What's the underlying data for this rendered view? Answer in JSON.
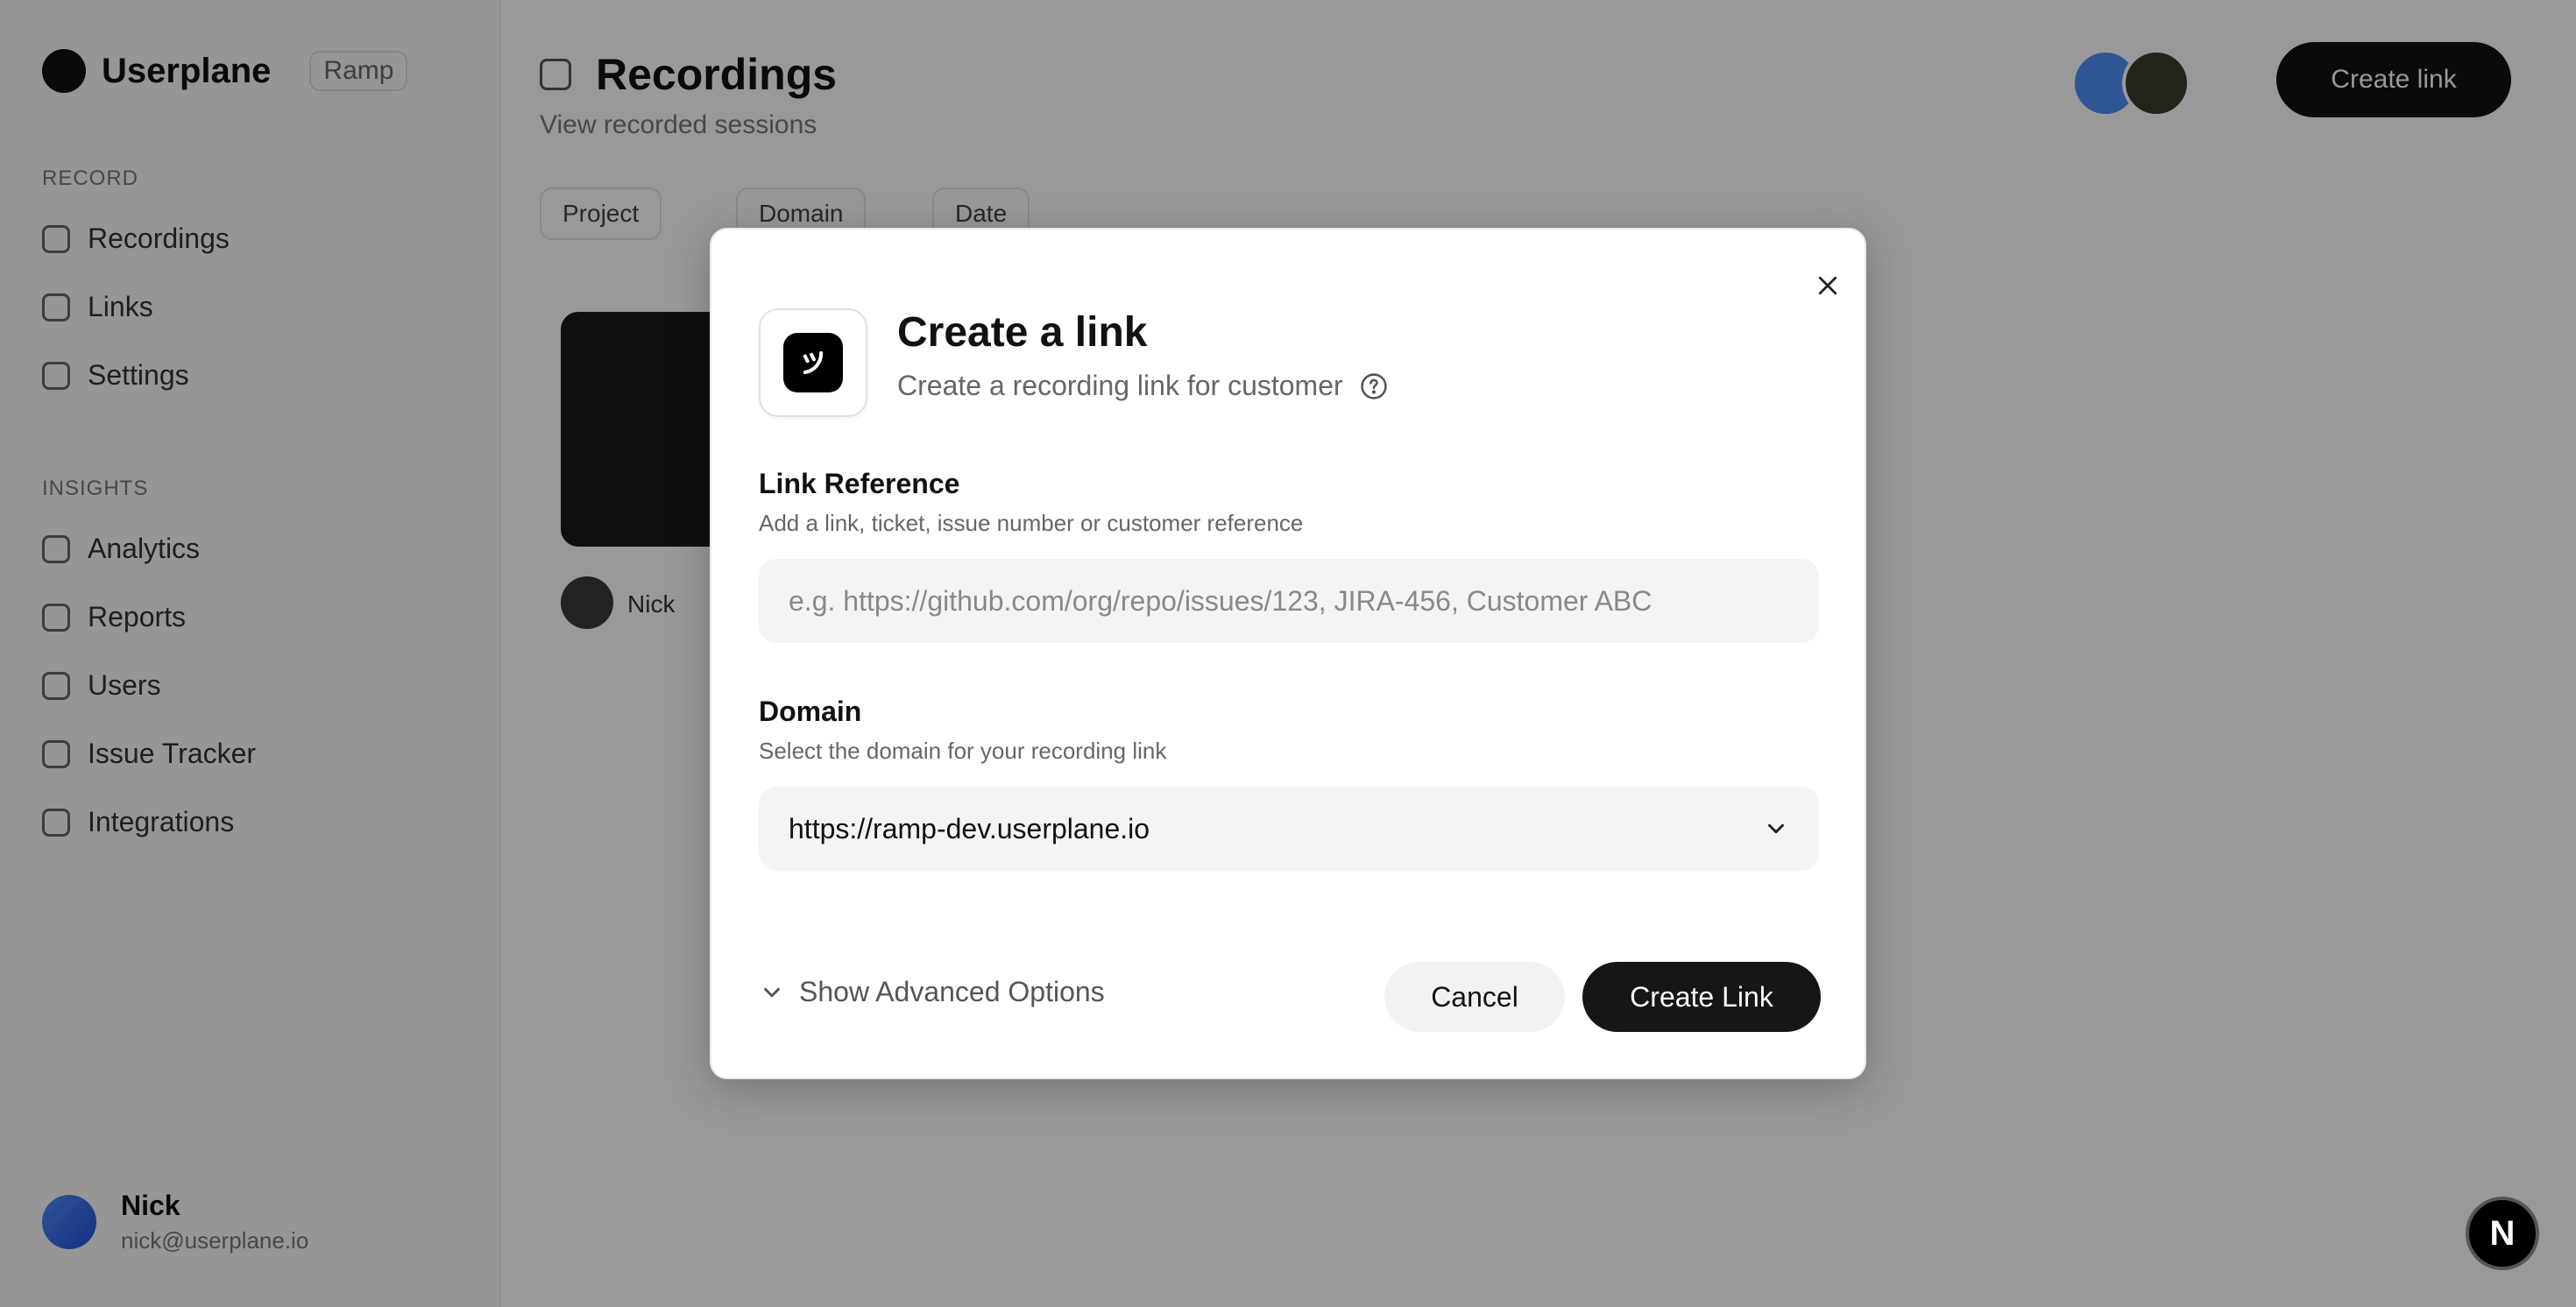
{
  "background": {
    "brand": {
      "name": "Userplane",
      "env": "Ramp"
    },
    "sidebar": {
      "group1": "RECORD",
      "items1": [
        {
          "label": "Recordings",
          "icon": "video-icon"
        },
        {
          "label": "Links",
          "icon": "link-icon"
        },
        {
          "label": "Settings",
          "icon": "settings-icon"
        }
      ],
      "group2": "INSIGHTS",
      "items2": [
        {
          "label": "Analytics",
          "icon": "chart-icon"
        },
        {
          "label": "Reports",
          "icon": "report-icon"
        },
        {
          "label": "Users",
          "icon": "users-icon"
        },
        {
          "label": "Issue Tracker",
          "icon": "issue-icon"
        },
        {
          "label": "Integrations",
          "icon": "plug-icon"
        }
      ]
    },
    "user": {
      "name": "Nick",
      "email": "nick@userplane.io"
    },
    "header": {
      "title": "Recordings",
      "subtitle": "View recorded sessions",
      "filters": [
        "Project",
        "Domain",
        "Date"
      ],
      "cta": "Create link"
    },
    "card": {
      "name": "Nick"
    }
  },
  "modal": {
    "title": "Create a link",
    "subtitle": "Create a recording link for customer",
    "link_reference": {
      "label": "Link Reference",
      "hint": "Add a link, ticket, issue number or customer reference",
      "placeholder": "e.g. https://github.com/org/repo/issues/123, JIRA-456, Customer ABC",
      "value": ""
    },
    "domain": {
      "label": "Domain",
      "hint": "Select the domain for your recording link",
      "selected": "https://ramp-dev.userplane.io"
    },
    "advanced_label": "Show Advanced Options",
    "cancel_label": "Cancel",
    "create_label": "Create Link"
  },
  "badge": {
    "letter": "N"
  },
  "colors": {
    "primary_button": "#161616",
    "input_bg": "#f4f4f4",
    "overlay": "rgba(0,0,0,0.40)"
  }
}
